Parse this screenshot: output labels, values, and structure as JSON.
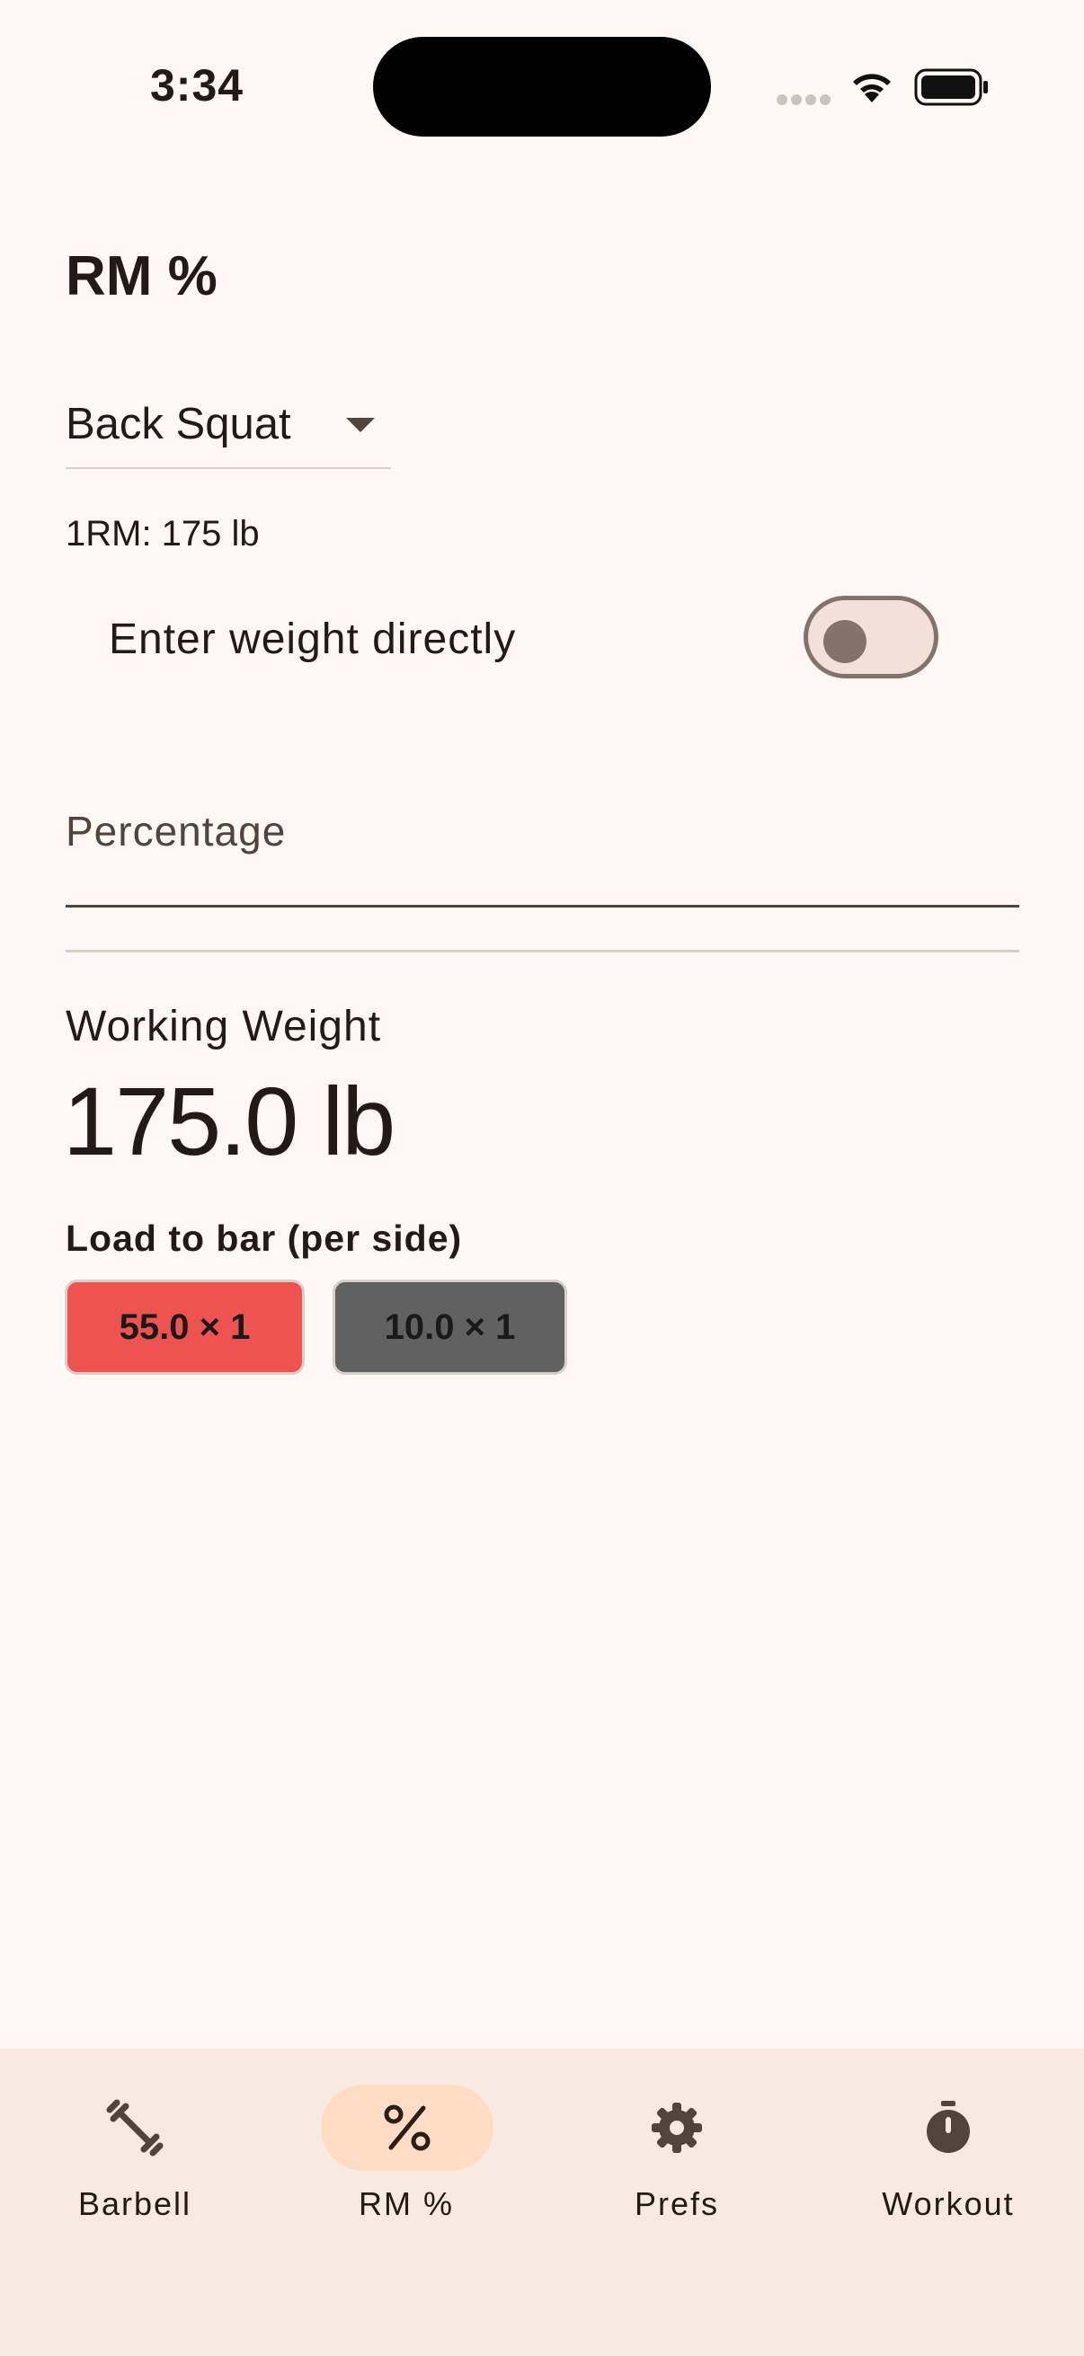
{
  "status_bar": {
    "time": "3:34"
  },
  "page": {
    "title": "RM %"
  },
  "exercise": {
    "selected": "Back Squat"
  },
  "one_rm": "1RM: 175 lb",
  "toggle": {
    "label": "Enter weight directly",
    "on": false
  },
  "percentage_field": {
    "label": "Percentage",
    "value": ""
  },
  "working_weight": {
    "label": "Working Weight",
    "value": "175.0 lb"
  },
  "load": {
    "title": "Load to bar (per side)",
    "plates": [
      {
        "label": "55.0 × 1",
        "color": "#EF5350"
      },
      {
        "label": "10.0 × 1",
        "color": "#616161"
      }
    ]
  },
  "nav": {
    "items": [
      {
        "label": "Barbell",
        "icon": "barbell-icon"
      },
      {
        "label": "RM %",
        "icon": "percent-icon",
        "active": true
      },
      {
        "label": "Prefs",
        "icon": "gear-icon"
      },
      {
        "label": "Workout",
        "icon": "stopwatch-icon"
      }
    ]
  },
  "colors": {
    "background": "#FFF8F5",
    "accent": "#FFDCC3",
    "nav_background": "#F8EAE0"
  }
}
